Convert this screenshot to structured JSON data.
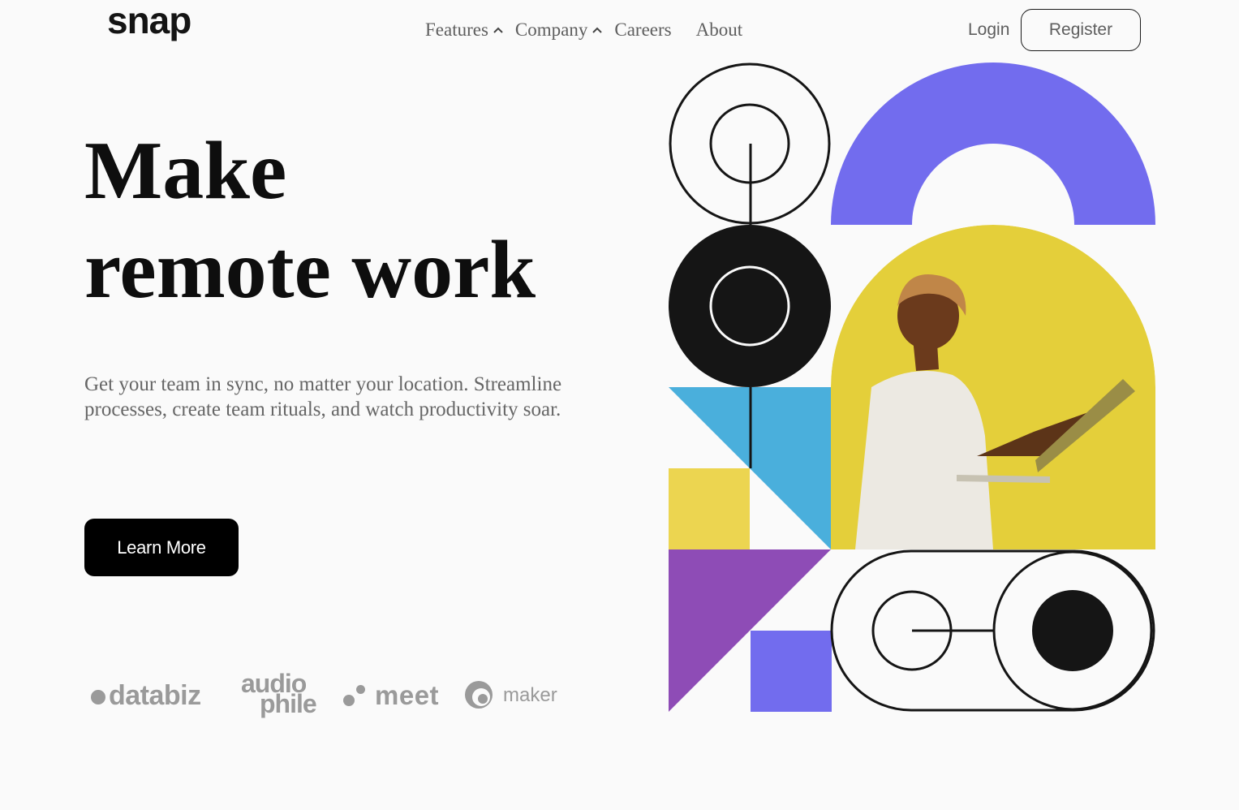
{
  "brand": {
    "logo": "snap"
  },
  "nav": {
    "items": [
      {
        "label": "Features",
        "has_dropdown": true
      },
      {
        "label": "Company",
        "has_dropdown": true
      },
      {
        "label": "Careers",
        "has_dropdown": false
      },
      {
        "label": "About",
        "has_dropdown": false
      }
    ],
    "chevron_icon": "chevron-up-icon"
  },
  "auth": {
    "login": "Login",
    "register": "Register"
  },
  "hero": {
    "title_line1": "Make",
    "title_line2": "remote work",
    "subtitle": "Get your team in sync, no matter your location. Streamline processes, create team rituals, and watch productivity soar.",
    "cta": "Learn More"
  },
  "clients": {
    "databiz": "databiz",
    "audiophile_top": "audio",
    "audiophile_bottom": "phile",
    "meet": "meet",
    "maker": "maker"
  },
  "colors": {
    "background": "#fafafa",
    "text_dark": "#0e0e0e",
    "text_muted": "#666666",
    "client_gray": "#9a9a9a",
    "violet": "#726cee",
    "blue": "#4aafdc",
    "yellow": "#ecd550",
    "purple": "#8e4cb6",
    "photo_yellow": "#e4cf3a"
  }
}
